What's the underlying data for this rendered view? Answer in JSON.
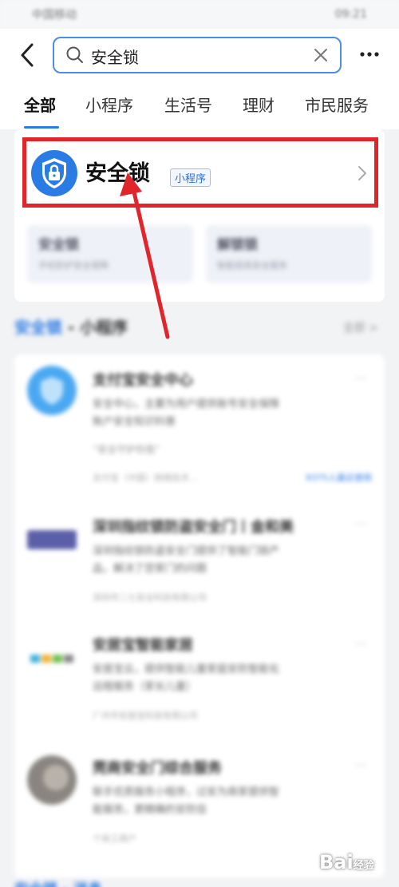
{
  "status_bar": {
    "carrier": "中国移动",
    "time": "09:21"
  },
  "search": {
    "query": "安全锁"
  },
  "tabs": [
    {
      "label": "全部",
      "active": true
    },
    {
      "label": "小程序",
      "active": false
    },
    {
      "label": "生活号",
      "active": false
    },
    {
      "label": "理财",
      "active": false
    },
    {
      "label": "市民服务",
      "active": false
    }
  ],
  "top_result": {
    "name": "安全锁",
    "badge": "小程序"
  },
  "sub_cards": [
    {
      "title": "安全锁",
      "desc": "手机防护安全保障"
    },
    {
      "title": "解锁锁",
      "desc": "智能锁具安全服务"
    }
  ],
  "section": {
    "highlight": "安全锁",
    "suffix": " - 小程序",
    "more": "全部 >"
  },
  "list": [
    {
      "title": "支付宝安全中心",
      "desc_line1": "安全中心，主要为用户提供账号安全保障",
      "desc_line2": "账户安全知识科普",
      "desc_line3": "“安全守护你我”",
      "meta": "支付宝（中国）网络技术...",
      "link": "9375人最近使用"
    },
    {
      "title": "深圳指纹锁防盗安全门丨金和美",
      "desc_line1": "深圳指纹锁防盗安全门提供了智能门锁产",
      "desc_line2": "品，解决了您家门的问题",
      "meta": "深圳市二七安全科技有限公司"
    },
    {
      "title": "安居宝智能家居",
      "desc_line1": "安居宝云，提供智能儿童家庭安防智能化",
      "desc_line2": "远程服务（家长儿童）",
      "meta": "广州市安居宝科技有限公司"
    },
    {
      "title": "莞商安全门综合服务",
      "desc_line1": "联手优质服务小程序，过安为商家提供智",
      "desc_line2": "能服务，更精确的安防信",
      "meta": "个体工商户"
    }
  ],
  "bottom_section": {
    "label": "安全锁 - 消息"
  },
  "watermark": {
    "text": "Bai",
    "suffix": "经验"
  },
  "colors": {
    "accent": "#2a7be4",
    "highlight_box": "#e0262b",
    "arrow": "#e0262b"
  }
}
